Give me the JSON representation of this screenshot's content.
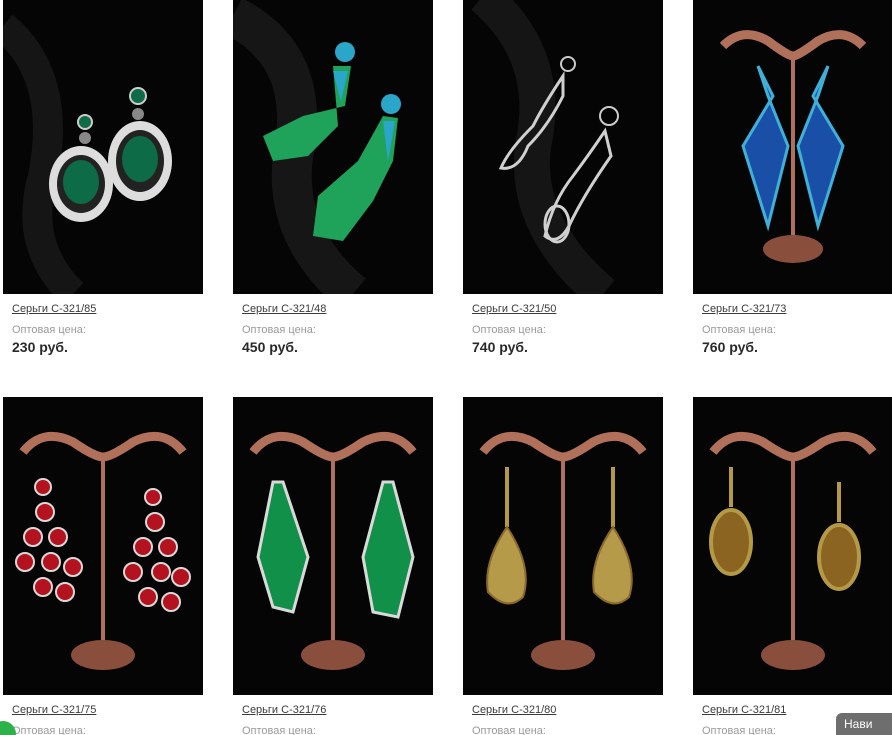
{
  "products": [
    {
      "title": "Серьги С-321/85",
      "price_label": "Оптовая цена:",
      "price": "230 руб.",
      "gem_color": "#0d6b47",
      "rim_color": "#e6e6e6"
    },
    {
      "title": "Серьги С-321/48",
      "price_label": "Оптовая цена:",
      "price": "450 руб.",
      "gem_color": "#1fa35a",
      "rim_color": "#2aa6c9"
    },
    {
      "title": "Серьги С-321/50",
      "price_label": "Оптовая цена:",
      "price": "740 руб.",
      "gem_color": "#bdbdbd",
      "rim_color": "#e0e0e0"
    },
    {
      "title": "Серьги С-321/73",
      "price_label": "Оптовая цена:",
      "price": "760 руб.",
      "gem_color": "#1a4fa8",
      "rim_color": "#3fb0d8"
    },
    {
      "title": "Серьги С-321/75",
      "price_label": "Оптовая цена:",
      "price": "",
      "gem_color": "#b3121e",
      "rim_color": "#d9d9d9"
    },
    {
      "title": "Серьги С-321/76",
      "price_label": "Оптовая цена:",
      "price": "",
      "gem_color": "#11904a",
      "rim_color": "#d9d9d9"
    },
    {
      "title": "Серьги С-321/80",
      "price_label": "Оптовая цена:",
      "price": "",
      "gem_color": "#b59a4a",
      "rim_color": "#8a6a2a"
    },
    {
      "title": "Серьги С-321/81",
      "price_label": "Оптовая цена:",
      "price": "",
      "gem_color": "#8a6420",
      "rim_color": "#b49a45"
    }
  ],
  "nav_tab": {
    "label": "Нави"
  },
  "colors": {
    "stand": "#b0705a",
    "photo_bg": "#050505"
  }
}
